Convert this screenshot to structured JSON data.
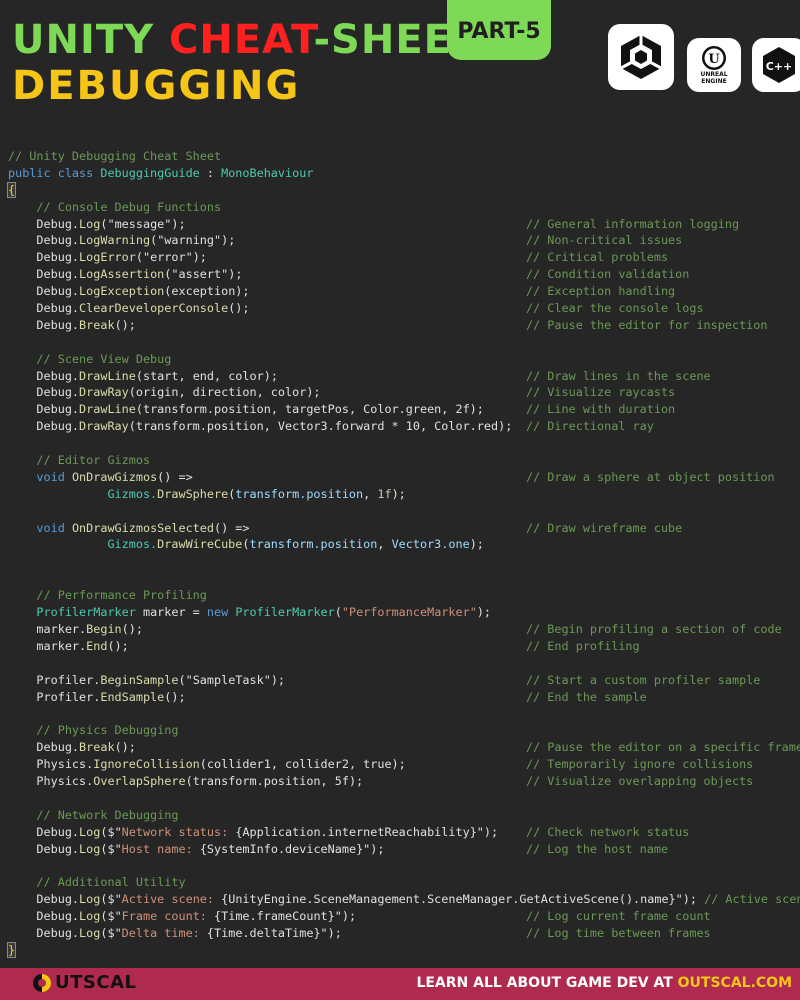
{
  "header": {
    "title_a": "UNITY ",
    "title_b": "CHEAT",
    "title_c": "-SHEET",
    "subtitle": "DEBUGGING",
    "part": "PART-5",
    "unreal_label_1": "UNREAL",
    "unreal_label_2": "ENGINE",
    "cpp_label": "C++"
  },
  "code": {
    "l1": "// Unity Debugging Cheat Sheet",
    "l2_kw": "public class ",
    "l2_cls": "DebuggingGuide",
    "l2_sep": " : ",
    "l2_base": "MonoBehaviour",
    "open_brace": "{",
    "close_brace": "}",
    "s1": "// Console Debug Functions",
    "s1_items": [
      {
        "obj": "Debug.",
        "fn": "Log",
        "args_a": "(",
        "str": "\"message\"",
        "args_b": ");",
        "comment": "// General information logging"
      },
      {
        "obj": "Debug.",
        "fn": "LogWarning",
        "args_a": "(",
        "str": "\"warning\"",
        "args_b": ");",
        "comment": "// Non-critical issues"
      },
      {
        "obj": "Debug.",
        "fn": "LogError",
        "args_a": "(",
        "str": "\"error\"",
        "args_b": ");",
        "comment": "// Critical problems"
      },
      {
        "obj": "Debug.",
        "fn": "LogAssertion",
        "args_a": "(",
        "str": "\"assert\"",
        "args_b": ");",
        "comment": "// Condition validation"
      },
      {
        "obj": "Debug.",
        "fn": "LogException",
        "args_a": "(exception);",
        "str": "",
        "args_b": "",
        "comment": "// Exception handling"
      },
      {
        "obj": "Debug.",
        "fn": "ClearDeveloperConsole",
        "args_a": "();",
        "str": "",
        "args_b": "",
        "comment": "// Clear the console logs"
      },
      {
        "obj": "Debug.",
        "fn": "Break",
        "args_a": "();",
        "str": "",
        "args_b": "",
        "comment": "// Pause the editor for inspection"
      }
    ],
    "s2": "// Scene View Debug",
    "s2_items": [
      {
        "obj": "Debug.",
        "fn": "DrawLine",
        "args": "(start, end, color);",
        "comment": "// Draw lines in the scene"
      },
      {
        "obj": "Debug.",
        "fn": "DrawRay",
        "args": "(origin, direction, color);",
        "comment": "// Visualize raycasts"
      },
      {
        "obj": "Debug.",
        "fn": "DrawLine",
        "args": "(transform.position, targetPos, Color.green, 2f);",
        "comment": "// Line with duration"
      },
      {
        "obj": "Debug.",
        "fn": "DrawRay",
        "args": "(transform.position, Vector3.forward * 10, Color.red);",
        "comment": "// Directional ray"
      }
    ],
    "s3": "// Editor Gizmos",
    "g1_kw": "void ",
    "g1_fn": "OnDrawGizmos",
    "g1_rest": "() =>",
    "g1_comment": "// Draw a sphere at object position",
    "g1_body_obj": "Gizmos.",
    "g1_body_fn": "DrawSphere",
    "g1_body_a": "(",
    "g1_body_var": "transform.position",
    "g1_body_b": ", ",
    "g1_body_num": "1f",
    "g1_body_c": ");",
    "g2_kw": "void ",
    "g2_fn": "OnDrawGizmosSelected",
    "g2_rest": "() =>",
    "g2_comment": "// Draw wireframe cube",
    "g2_body_obj": "Gizmos.",
    "g2_body_fn": "DrawWireCube",
    "g2_body_a": "(",
    "g2_body_var": "transform.position",
    "g2_body_b": ", ",
    "g2_body_var2": "Vector3.one",
    "g2_body_c": ");",
    "s4": "// Performance Profiling",
    "p1_cls": "ProfilerMarker",
    "p1_var": " marker = ",
    "p1_kw": "new ",
    "p1_cls2": "ProfilerMarker",
    "p1_a": "(",
    "p1_str": "\"PerformanceMarker\"",
    "p1_b": ");",
    "p2_obj": "marker.",
    "p2_fn": "Begin",
    "p2_args": "();",
    "p2_comment": "// Begin profiling a section of code",
    "p3_obj": "marker.",
    "p3_fn": "End",
    "p3_args": "();",
    "p3_comment": "// End profiling",
    "p4_obj": "Profiler.",
    "p4_fn": "BeginSample",
    "p4_a": "(",
    "p4_str": "\"SampleTask\"",
    "p4_b": ");",
    "p4_comment": "// Start a custom profiler sample",
    "p5_obj": "Profiler.",
    "p5_fn": "EndSample",
    "p5_args": "();",
    "p5_comment": "// End the sample",
    "s5": "// Physics Debugging",
    "s5_items": [
      {
        "obj": "Debug.",
        "fn": "Break",
        "args": "();",
        "comment": "// Pause the editor on a specific frame"
      },
      {
        "obj": "Physics.",
        "fn": "IgnoreCollision",
        "args": "(collider1, collider2, true);",
        "comment": "// Temporarily ignore collisions"
      },
      {
        "obj": "Physics.",
        "fn": "OverlapSphere",
        "args": "(transform.position, 5f);",
        "comment": "// Visualize overlapping objects"
      }
    ],
    "s6": "// Network Debugging",
    "n1_obj": "Debug.",
    "n1_fn": "Log",
    "n1_a": "($\"",
    "n1_str": "Network status: ",
    "n1_var": "{Application.internetReachability}",
    "n1_b": "\");",
    "n1_comment": "// Check network status",
    "n2_obj": "Debug.",
    "n2_fn": "Log",
    "n2_a": "($\"",
    "n2_str": "Host name: ",
    "n2_var": "{SystemInfo.deviceName}",
    "n2_b": "\");",
    "n2_comment": "// Log the host name",
    "s7": "// Additional Utility",
    "u1_obj": "Debug.",
    "u1_fn": "Log",
    "u1_a": "($\"",
    "u1_str": "Active scene: ",
    "u1_var": "{UnityEngine.SceneManagement.SceneManager.GetActiveScene().name}",
    "u1_b": "\"); ",
    "u1_comment": "// Active scene",
    "u2_obj": "Debug.",
    "u2_fn": "Log",
    "u2_a": "($\"",
    "u2_str": "Frame count: ",
    "u2_var": "{Time.frameCount}",
    "u2_b": "\");",
    "u2_comment": "// Log current frame count",
    "u3_obj": "Debug.",
    "u3_fn": "Log",
    "u3_a": "($\"",
    "u3_str": "Delta time: ",
    "u3_var": "{Time.deltaTime}",
    "u3_b": "\");",
    "u3_comment": "// Log time between frames"
  },
  "footer": {
    "brand": "UTSCAL",
    "cta_a": "LEARN ALL ABOUT GAME DEV AT ",
    "cta_b": "OUTSCAL.COM"
  }
}
